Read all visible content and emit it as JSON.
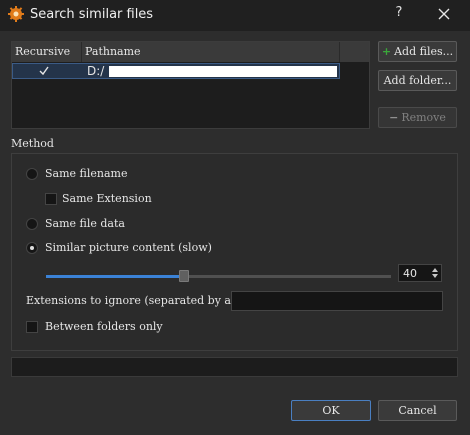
{
  "window": {
    "title": "Search similar files",
    "help_label": "?",
    "app_icon": "orange-gear-icon",
    "close_icon": "close-icon"
  },
  "files_table": {
    "columns": [
      "Recursive",
      "Pathname"
    ],
    "rows": [
      {
        "recursive": true,
        "pathname": "D:/"
      }
    ]
  },
  "side_buttons": {
    "add_files": "Add files...",
    "add_folder": "Add folder...",
    "remove": "Remove"
  },
  "method": {
    "label": "Method",
    "options": {
      "same_filename": {
        "label": "Same filename",
        "selected": false
      },
      "same_extension": {
        "label": "Same Extension",
        "checked": false
      },
      "same_file_data": {
        "label": "Same file data",
        "selected": false
      },
      "similar_picture": {
        "label": "Similar picture content (slow)",
        "selected": true
      }
    },
    "similarity": {
      "value": "40",
      "slider_fraction": 0.4
    },
    "extensions_to_ignore": {
      "label": "Extensions to ignore (separated by a space)",
      "value": ""
    },
    "between_folders_only": {
      "label": "Between folders only",
      "checked": false
    }
  },
  "footer": {
    "ok": "OK",
    "cancel": "Cancel"
  },
  "colors": {
    "accent": "#3b82d6",
    "add_green": "#3aa83a",
    "background": "#2d2d2d"
  }
}
